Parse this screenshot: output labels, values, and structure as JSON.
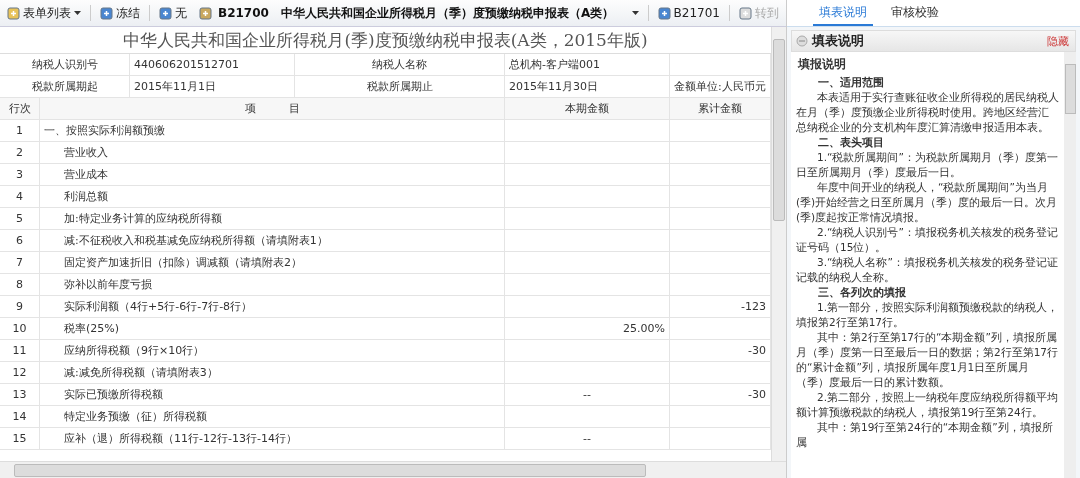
{
  "toolbar": {
    "items": [
      {
        "kind": "menu",
        "label": "表单列表"
      },
      {
        "kind": "button",
        "label": "冻结"
      },
      {
        "kind": "button",
        "label": "无"
      },
      {
        "kind": "select",
        "code": "B21700",
        "label": "中华人民共和国企业所得税月（季）度预缴纳税申报表（A类）"
      },
      {
        "kind": "button",
        "label": "B21701"
      },
      {
        "kind": "disabled",
        "label": "转到"
      }
    ]
  },
  "form": {
    "title": "中华人民共和国企业所得税月(季)度预缴纳税申报表(A类，2015年版)",
    "info_rows": [
      [
        "纳税人识别号",
        "440606201512701",
        "纳税人名称",
        "总机构-客户端001"
      ],
      [
        "税款所属期起",
        "2015年11月1日",
        "税款所属期止",
        "2015年11月30日",
        "金额单位:人民币元"
      ]
    ],
    "columns": [
      "行次",
      "项　　　目",
      "本期金额",
      "累计金额"
    ],
    "rows": [
      {
        "no": "1",
        "item": "一、按照实际利润额预缴",
        "children": [
          {
            "no": "2",
            "item": "营业收入"
          },
          {
            "no": "3",
            "item": "营业成本"
          },
          {
            "no": "4",
            "item": "利润总额"
          },
          {
            "no": "5",
            "item": "加:特定业务计算的应纳税所得额"
          },
          {
            "no": "6",
            "item": "减:不征税收入和税基减免应纳税所得额（请填附表1）"
          },
          {
            "no": "7",
            "item": "固定资产加速折旧（扣除）调减额（请填附表2）"
          },
          {
            "no": "8",
            "item": "弥补以前年度亏损"
          },
          {
            "no": "9",
            "item": "实际利润额（4行+5行-6行-7行-8行）",
            "cumulative": "-123"
          },
          {
            "no": "10",
            "item": "税率(25%)",
            "current": "25.00%"
          },
          {
            "no": "11",
            "item": "应纳所得税额（9行×10行）",
            "cumulative": "-30"
          },
          {
            "no": "12",
            "item": "减:减免所得税额（请填附表3）"
          },
          {
            "no": "13",
            "item": "实际已预缴所得税额",
            "current": "--",
            "cumulative": "-30"
          },
          {
            "no": "14",
            "item": "特定业务预缴（征）所得税额"
          },
          {
            "no": "15",
            "item": "应补（退）所得税额（11行-12行-13行-14行）",
            "current": "--"
          }
        ]
      }
    ]
  },
  "side": {
    "tabs": [
      {
        "label": "填表说明",
        "selected": true
      },
      {
        "label": "审核校验",
        "selected": false
      }
    ],
    "panel_title": "填表说明",
    "hide_link": "隐藏",
    "heading": "填报说明",
    "blocks": [
      {
        "kind": "section",
        "text": "一、适用范围"
      },
      {
        "kind": "para",
        "text": "本表适用于实行查账征收企业所得税的居民纳税人在月（季）度预缴企业所得税时使用。跨地区经营汇总纳税企业的分支机构年度汇算清缴申报适用本表。"
      },
      {
        "kind": "section",
        "text": "二、表头项目"
      },
      {
        "kind": "para",
        "text": "1.“税款所属期间”：为税款所属期月（季）度第一日至所属期月（季）度最后一日。"
      },
      {
        "kind": "para",
        "text": "年度中间开业的纳税人，“税款所属期间”为当月(季)开始经营之日至所属月（季）度的最后一日。次月(季)度起按正常情况填报。"
      },
      {
        "kind": "para",
        "text": "2.“纳税人识别号”：填报税务机关核发的税务登记证号码（15位）。"
      },
      {
        "kind": "para",
        "text": "3.“纳税人名称”：填报税务机关核发的税务登记证记载的纳税人全称。"
      },
      {
        "kind": "section",
        "text": "三、各列次的填报"
      },
      {
        "kind": "para",
        "text": "1.第一部分，按照实际利润额预缴税款的纳税人，填报第2行至第17行。"
      },
      {
        "kind": "para",
        "text": "其中：第2行至第17行的“本期金额”列，填报所属月（季）度第一日至最后一日的数据；第2行至第17行的“累计金额”列，填报所属年度1月1日至所属月（季）度最后一日的累计数额。"
      },
      {
        "kind": "para",
        "text": "2.第二部分，按照上一纳税年度应纳税所得额平均额计算预缴税款的纳税人，填报第19行至第24行。"
      },
      {
        "kind": "para",
        "text": "其中：第19行至第24行的“本期金额”列，填报所属"
      }
    ]
  }
}
